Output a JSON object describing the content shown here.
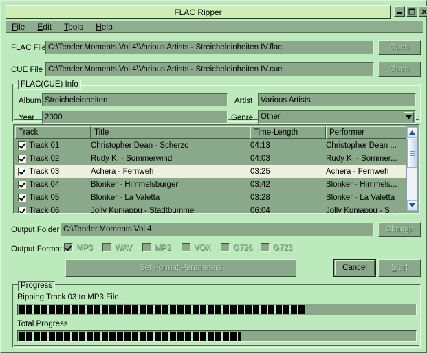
{
  "window": {
    "title": "FLAC Ripper",
    "buttons": {
      "minimize": "minimize-icon",
      "maximize": "maximize-icon",
      "close": "close-icon"
    }
  },
  "menu": [
    {
      "accel": "F",
      "rest": "ile"
    },
    {
      "accel": "E",
      "rest": "dit"
    },
    {
      "accel": "T",
      "rest": "ools"
    },
    {
      "accel": "H",
      "rest": "elp"
    }
  ],
  "files": {
    "flac_label": "FLAC File",
    "flac_path": "C:\\Tender.Moments.Vol.4\\Various Artists - Streicheleinheiten IV.flac",
    "flac_open_button": "Open",
    "cue_label": "CUE File",
    "cue_path": "C:\\Tender.Moments.Vol.4\\Various Artists - Streicheleinheiten IV.cue",
    "cue_open_button": "Open"
  },
  "info": {
    "group_title": "FLAC(CUE) Info",
    "album_label": "Album",
    "album_value": "Streicheleinheiten",
    "artist_label": "Artist",
    "artist_value": "Various Artists",
    "year_label": "Year",
    "year_value": "2000",
    "genre_label": "Genre",
    "genre_value": "Other"
  },
  "tracklist": {
    "columns": [
      "Track",
      "Title",
      "Time-Length",
      "Performer"
    ],
    "rows": [
      {
        "checked": true,
        "track": "Track 01",
        "title": "Christopher Dean - Scherzo",
        "time": "04:13",
        "performer": "Christopher Dean ...",
        "selected": false
      },
      {
        "checked": true,
        "track": "Track 02",
        "title": "Rudy K. - Sommerwind",
        "time": "04:03",
        "performer": "Rudy K. - Sommer...",
        "selected": false
      },
      {
        "checked": true,
        "track": "Track 03",
        "title": "Achera - Fernweh",
        "time": "03:25",
        "performer": "Achera - Fernweh",
        "selected": true
      },
      {
        "checked": true,
        "track": "Track 04",
        "title": "Blonker - Himmelsburgen",
        "time": "03:42",
        "performer": "Blonker - Himmels...",
        "selected": false
      },
      {
        "checked": true,
        "track": "Track 05",
        "title": "Blonker - La Valetta",
        "time": "03:28",
        "performer": "Blonker - La Valetta",
        "selected": false
      },
      {
        "checked": true,
        "track": "Track 06",
        "title": "Jolly Kunjappu - Stadtbummel",
        "time": "06:04",
        "performer": "Jolly Kunjappu - S...",
        "selected": false
      }
    ]
  },
  "output": {
    "folder_label": "Output Folder",
    "folder_value": "C:\\Tender.Moments.Vol.4",
    "change_button": "Change",
    "format_label": "Output Format:",
    "formats": [
      {
        "name": "MP3",
        "checked": true
      },
      {
        "name": "WAV",
        "checked": false
      },
      {
        "name": "MP2",
        "checked": false
      },
      {
        "name": "VOX",
        "checked": false
      },
      {
        "name": "G726",
        "checked": false
      },
      {
        "name": "G723",
        "checked": false
      }
    ]
  },
  "actions": {
    "set_format_parameters": "Set Format Parameters",
    "cancel": "Cancel",
    "cancel_accel": "C",
    "cancel_rest": "ancel",
    "start": "Start",
    "start_accel": "S",
    "start_rest": "tart"
  },
  "progress": {
    "group_title": "Progress",
    "current_status": "Ripping Track 03 to MP3 File ...",
    "current_percent": 72,
    "total_label": "Total Progress",
    "total_percent": 56
  },
  "colors": {
    "window_bg": "#bdeabd",
    "panel_bg": "#8aa98a",
    "title_bg": "#cdeeb4",
    "selection_bg": "#eef0df",
    "bar_fill": "#000000"
  }
}
